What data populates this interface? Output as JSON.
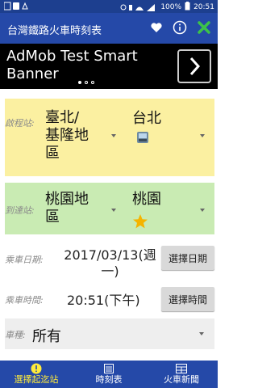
{
  "status": {
    "battery": "100%",
    "time": "20:51"
  },
  "app": {
    "title": "台灣鐵路火車時刻表"
  },
  "ad": {
    "line1": "AdMob Test Smart",
    "line2": "Banner"
  },
  "departure": {
    "label": "啟程站:",
    "area_line1": "臺北/",
    "area_line2": "基隆地",
    "area_line3": "區",
    "station": "台北"
  },
  "arrival": {
    "label": "到達站:",
    "area_line1": "桃園地",
    "area_line2": "區",
    "station": "桃園"
  },
  "date": {
    "label": "乘車日期:",
    "value_line1": "2017/03/13(週",
    "value_line2": "一)",
    "button": "選擇日期"
  },
  "time": {
    "label": "乘車時間:",
    "value": "20:51(下午)",
    "button": "選擇時間"
  },
  "train_type": {
    "label": "車種:",
    "value": "所有"
  },
  "nav": {
    "tab1": "選擇起迄站",
    "tab2": "時刻表",
    "tab3": "火車新聞"
  },
  "colors": {
    "appbar": "#2549a8",
    "departure_bg": "#fbf0a1",
    "arrival_bg": "#c9ebb3",
    "selected_tab": "#ffeb3b",
    "close_icon": "#3cc24a"
  }
}
